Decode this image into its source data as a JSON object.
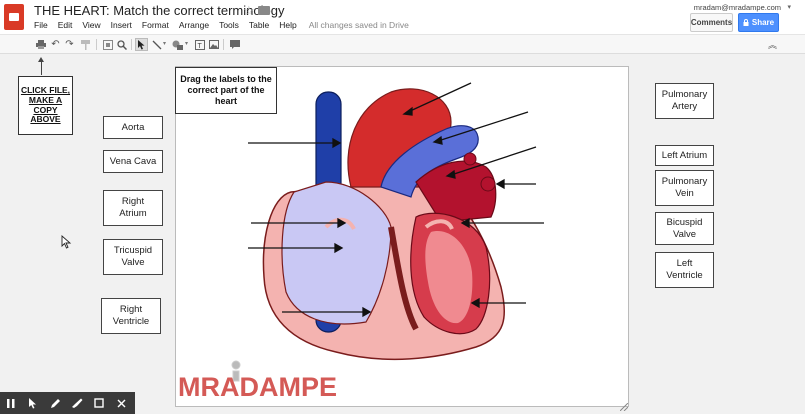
{
  "header": {
    "title": "THE HEART: Match the correct terminology",
    "menu": [
      "File",
      "Edit",
      "View",
      "Insert",
      "Format",
      "Arrange",
      "Tools",
      "Table",
      "Help"
    ],
    "save_status": "All changes saved in Drive",
    "user_email": "mradam@mradampe.com",
    "comments_label": "Comments",
    "share_label": "Share"
  },
  "note": {
    "text": "CLICK FILE, MAKE A COPY ABOVE"
  },
  "slide": {
    "title": "Drag the labels to the correct part of the heart",
    "logo": "MRADAMPE"
  },
  "labels": {
    "left": [
      "Aorta",
      "Vena Cava",
      "Right Atrium",
      "Tricuspid Valve",
      "Right Ventricle"
    ],
    "right": [
      "Pulmonary Artery",
      "Left Atrium",
      "Pulmonary Vein",
      "Bicuspid Valve",
      "Left Ventricle"
    ]
  },
  "icons": {
    "toolbar": [
      "print-icon",
      "undo-icon",
      "redo-icon",
      "paint-format-icon",
      "zoom-fit-icon",
      "zoom-icon",
      "select-icon",
      "line-icon",
      "shape-icon",
      "text-box-icon",
      "image-icon",
      "comment-icon",
      "collapse-icon"
    ],
    "annotation": [
      "pause-icon",
      "pointer-icon",
      "pen-icon",
      "highlighter-icon",
      "rectangle-icon",
      "close-icon"
    ]
  },
  "colors": {
    "share": "#4d90fe",
    "heart_red": "#c8102e",
    "heart_blue": "#1f3fa8",
    "logo": "#d45a56"
  }
}
